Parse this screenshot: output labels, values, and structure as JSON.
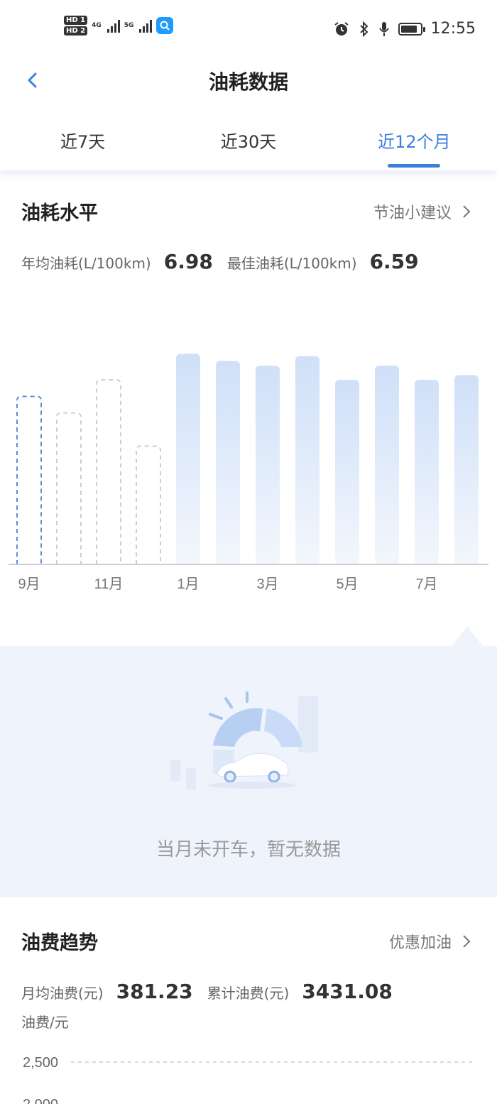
{
  "status_bar": {
    "time": "12:55",
    "sim1": "HD 1",
    "sim2": "HD 2",
    "net1": "4G",
    "net2": "5G"
  },
  "header": {
    "title": "油耗数据"
  },
  "tabs": [
    {
      "label": "近7天",
      "active": false
    },
    {
      "label": "近30天",
      "active": false
    },
    {
      "label": "近12个月",
      "active": true
    }
  ],
  "consumption": {
    "title": "油耗水平",
    "link": "节油小建议",
    "avg_label": "年均油耗(L/100km)",
    "avg_value": "6.98",
    "best_label": "最佳油耗(L/100km)",
    "best_value": "6.59"
  },
  "chart_data": {
    "type": "bar",
    "categories": [
      "9月",
      "10月",
      "11月",
      "12月",
      "1月",
      "2月",
      "3月",
      "4月",
      "5月",
      "6月",
      "7月",
      "8月"
    ],
    "x_tick_labels_shown": [
      "9月",
      "11月",
      "1月",
      "3月",
      "5月",
      "7月"
    ],
    "values": [
      null,
      null,
      null,
      null,
      6.98,
      6.92,
      6.88,
      6.96,
      6.76,
      6.88,
      6.76,
      6.8
    ],
    "placeholder_values": [
      6.62,
      6.48,
      6.76,
      6.2,
      null,
      null,
      null,
      null,
      null,
      null,
      null,
      null
    ],
    "selected_category": "9月",
    "colors": {
      "bar": "#cfe0f8",
      "placeholder_selected": "#5b8fd6",
      "placeholder": "#c9cfd8",
      "axis": "#cccccc"
    }
  },
  "empty_state": {
    "text": "当月未开车，暂无数据"
  },
  "cost": {
    "title": "油费趋势",
    "link": "优惠加油",
    "avg_label": "月均油费(元)",
    "avg_value": "381.23",
    "total_label": "累计油费(元)",
    "total_value": "3431.08",
    "unit_label": "油费/元",
    "y_ticks": [
      "2,500",
      "2,000"
    ]
  },
  "colors": {
    "accent": "#3b7ee0",
    "empty_bg": "#eef3fc"
  }
}
